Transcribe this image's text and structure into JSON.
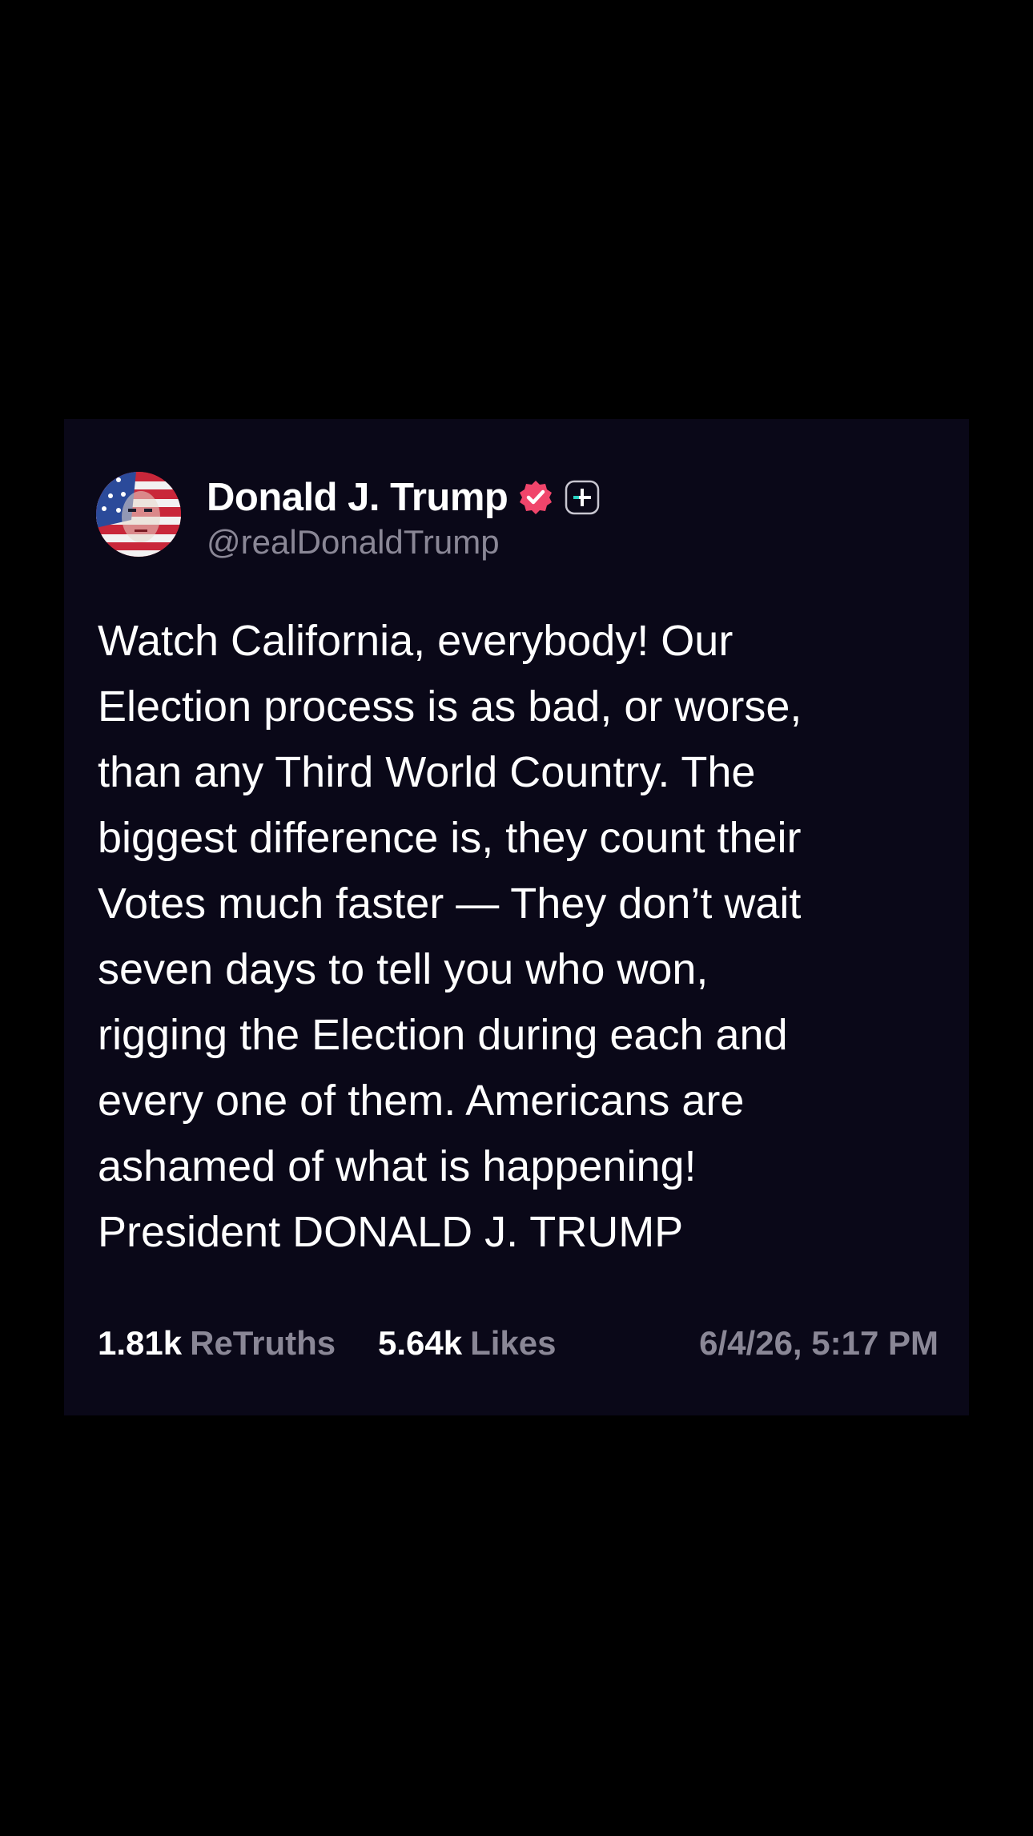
{
  "post": {
    "display_name": "Donald J. Trump",
    "handle": "@realDonaldTrump",
    "verified_icon": "verified-badge-icon",
    "plus_icon": "plus-badge-icon",
    "avatar_icon": "avatar-image",
    "body": "Watch California, everybody! Our\nElection process is as bad, or worse,\nthan any Third World Country. The\nbiggest difference is, they count their\nVotes much faster — They don’t wait\nseven days to tell you who won,\nrigging the Election during each and\nevery one of them. Americans are\nashamed of what is happening!\nPresident DONALD J. TRUMP",
    "retruths_count": "1.81k",
    "retruths_label": "ReTruths",
    "likes_count": "5.64k",
    "likes_label": "Likes",
    "timestamp": "6/4/26, 5:17 PM"
  },
  "colors": {
    "page_background": "#000000",
    "card_background": "#0a0818",
    "primary_text": "#ffffff",
    "secondary_text": "#8a8796",
    "verified_badge": "#f0456b",
    "plus_badge": "#2bd4c4"
  }
}
